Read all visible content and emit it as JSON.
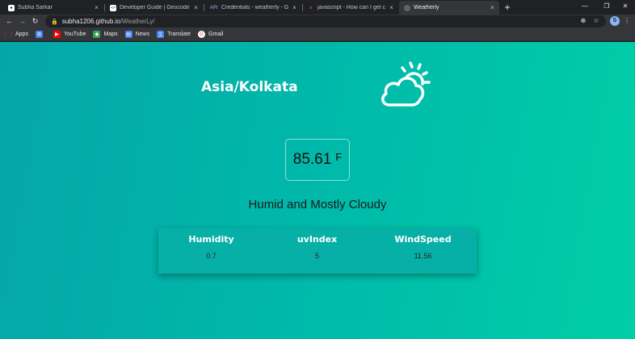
{
  "tabs": [
    {
      "title": "Subha Sarkar",
      "favicon": "github-icon",
      "color": "#ffffff"
    },
    {
      "title": "Developer Guide | Geocoding A",
      "favicon": "code-icon",
      "color": "#ffffff"
    },
    {
      "title": "Credentials - weatherly - Google",
      "favicon": "api-icon",
      "color": "#4285f4"
    },
    {
      "title": "javascript - How can I get city na",
      "favicon": "stackoverflow-icon",
      "color": "#f48024"
    },
    {
      "title": "Weatherly",
      "favicon": "globe-icon",
      "color": "#9aa0a6",
      "active": true
    }
  ],
  "address": {
    "host": "subha1206.github.io",
    "path": "/WeatherLy/"
  },
  "bookmarks": [
    {
      "label": "Apps",
      "icon": "apps-grid-icon",
      "color": "#ea4335"
    },
    {
      "label": "",
      "icon": "windows-icon",
      "color": "#4285f4"
    },
    {
      "label": "YouTube",
      "icon": "youtube-icon",
      "color": "#ff0000"
    },
    {
      "label": "Maps",
      "icon": "maps-icon",
      "color": "#34a853"
    },
    {
      "label": "News",
      "icon": "news-icon",
      "color": "#4285f4"
    },
    {
      "label": "Translate",
      "icon": "translate-icon",
      "color": "#4285f4"
    },
    {
      "label": "Gmail",
      "icon": "gmail-icon",
      "color": "#ffffff"
    }
  ],
  "weather": {
    "location": "Asia/Kolkata",
    "icon": "partly-cloudy-icon",
    "temperature": "85.61",
    "unit": "F",
    "summary": "Humid and Mostly Cloudy",
    "stats": [
      {
        "label": "Humidity",
        "value": "0.7"
      },
      {
        "label": "uvIndex",
        "value": "5"
      },
      {
        "label": "WindSpeed",
        "value": "11.56"
      }
    ]
  },
  "colors": {
    "gradient_start": "#05a6a8",
    "gradient_end": "#00cea7",
    "panel": "#07b0a6"
  }
}
